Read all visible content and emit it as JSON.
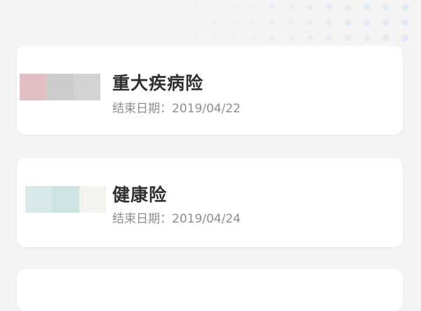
{
  "policies": [
    {
      "title": "重大疾病险",
      "end_label": "结束日期：",
      "end_date": "2019/04/22",
      "thumb_colors": [
        "#e2bfc3",
        "#cbcbcb",
        "#d3d3d3"
      ]
    },
    {
      "title": "健康险",
      "end_label": "结束日期：",
      "end_date": "2019/04/24",
      "thumb_colors": [
        "#d7e8e8",
        "#cde3e1",
        "#f3f3ef"
      ]
    }
  ],
  "colors": {
    "background": "#f4f4f5",
    "card": "#ffffff",
    "title_text": "#2f2f2f",
    "subtitle_text": "#8e8e8e",
    "decor_dots": "#dfe9f4"
  }
}
